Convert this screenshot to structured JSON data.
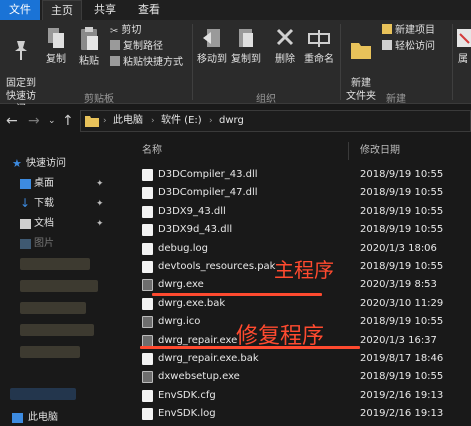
{
  "tabs": [
    "文件",
    "主页",
    "共享",
    "查看"
  ],
  "ribbon": {
    "pin_quick": "固定到\n快速访问",
    "copy": "复制",
    "paste": "粘贴",
    "cut": "剪切",
    "copy_path": "复制路径",
    "paste_shortcut": "粘贴快捷方式",
    "move_to": "移动到",
    "copy_to": "复制到",
    "delete": "删除",
    "rename": "重命名",
    "new_folder": "新建\n文件夹",
    "new_item": "新建项目",
    "easy_access": "轻松访问",
    "properties_partial": "属",
    "group_clipboard": "剪贴板",
    "group_organize": "组织",
    "group_new": "新建"
  },
  "address": {
    "crumbs": [
      "此电脑",
      "软件 (E:)",
      "dwrg"
    ]
  },
  "sidebar": {
    "items": [
      {
        "label": "快速访问",
        "icon": "star-icon"
      },
      {
        "label": "桌面",
        "icon": "desktop-icon"
      },
      {
        "label": "下载",
        "icon": "download-icon"
      },
      {
        "label": "文档",
        "icon": "document-icon"
      },
      {
        "label": "图片",
        "icon": "picture-icon"
      },
      {
        "label": "此电脑",
        "icon": "computer-icon"
      }
    ],
    "pin": "📌"
  },
  "columns": {
    "name": "名称",
    "modified": "修改日期"
  },
  "files": [
    {
      "name": "D3DCompiler_43.dll",
      "date": "2018/9/19 10:55",
      "type": "doc"
    },
    {
      "name": "D3DCompiler_47.dll",
      "date": "2018/9/19 10:55",
      "type": "doc"
    },
    {
      "name": "D3DX9_43.dll",
      "date": "2018/9/19 10:55",
      "type": "doc"
    },
    {
      "name": "D3DX9d_43.dll",
      "date": "2018/9/19 10:55",
      "type": "doc"
    },
    {
      "name": "debug.log",
      "date": "2020/1/3 18:06",
      "type": "doc"
    },
    {
      "name": "devtools_resources.pak",
      "date": "2018/9/19 10:55",
      "type": "doc"
    },
    {
      "name": "dwrg.exe",
      "date": "2020/3/19 8:53",
      "type": "app"
    },
    {
      "name": "dwrg.exe.bak",
      "date": "2020/3/10 11:29",
      "type": "doc"
    },
    {
      "name": "dwrg.ico",
      "date": "2018/9/19 10:55",
      "type": "app"
    },
    {
      "name": "dwrg_repair.exe",
      "date": "2020/1/3 16:37",
      "type": "app"
    },
    {
      "name": "dwrg_repair.exe.bak",
      "date": "2019/8/17 18:46",
      "type": "doc"
    },
    {
      "name": "dxwebsetup.exe",
      "date": "2018/9/19 10:55",
      "type": "app"
    },
    {
      "name": "EnvSDK.cfg",
      "date": "2019/2/16 19:13",
      "type": "doc"
    },
    {
      "name": "EnvSDK.log",
      "date": "2019/2/16 19:13",
      "type": "doc"
    }
  ],
  "annotations": {
    "main_program": "主程序",
    "repair_program": "修复程序"
  },
  "colors": {
    "accent": "#1a73d6",
    "annotation": "#ff4a2f",
    "background": "#191919"
  }
}
